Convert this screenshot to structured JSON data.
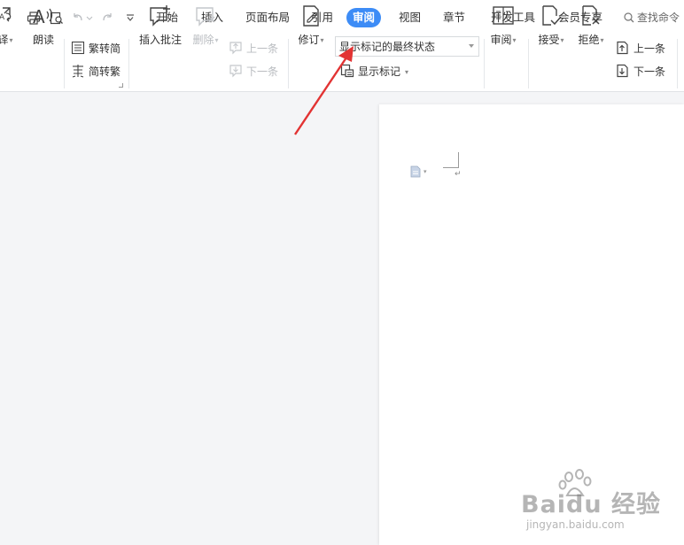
{
  "tabs": [
    {
      "label": "开始",
      "active": false
    },
    {
      "label": "插入",
      "active": false
    },
    {
      "label": "页面布局",
      "active": false
    },
    {
      "label": "引用",
      "active": false
    },
    {
      "label": "审阅",
      "active": true
    },
    {
      "label": "视图",
      "active": false
    },
    {
      "label": "章节",
      "active": false
    },
    {
      "label": "开发工具",
      "active": false
    },
    {
      "label": "会员专享",
      "active": false
    }
  ],
  "search": {
    "label": "查找命令"
  },
  "ribbon": {
    "translate_label": "翻译",
    "read_aloud_label": "朗读",
    "trad_convert_label": "繁转简",
    "simp_convert_label": "简转繁",
    "insert_comment_label": "插入批注",
    "delete_label": "删除",
    "prev_comment_label": "上一条",
    "next_comment_label": "下一条",
    "track_changes_label": "修订",
    "markup_mode_value": "显示标记的最终状态",
    "show_markup_label": "显示标记",
    "review_label": "审阅",
    "accept_label": "接受",
    "reject_label": "拒绝",
    "prev_change_label": "上一条",
    "next_change_label": "下一条"
  },
  "colors": {
    "accent": "#3d8cf6",
    "arrow": "#e23333",
    "canvas": "#f4f5f7"
  },
  "watermark": {
    "main": "Baidu 经验",
    "sub": "jingyan.baidu.com"
  }
}
